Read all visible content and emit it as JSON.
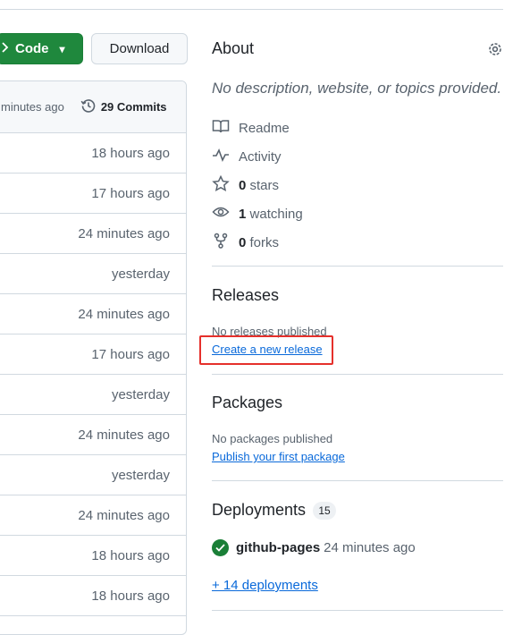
{
  "toolbar": {
    "code_label": "Code",
    "download_label": "Download"
  },
  "file_list": {
    "header_time": "minutes ago",
    "commits_label": "29 Commits",
    "rows": [
      "18 hours ago",
      "17 hours ago",
      "24 minutes ago",
      "yesterday",
      "24 minutes ago",
      "17 hours ago",
      "yesterday",
      "24 minutes ago",
      "yesterday",
      "24 minutes ago",
      "18 hours ago",
      "18 hours ago"
    ]
  },
  "about": {
    "title": "About",
    "description": "No description, website, or topics provided.",
    "readme": "Readme",
    "activity": "Activity",
    "stars_count": "0",
    "stars_label": "stars",
    "watching_count": "1",
    "watching_label": "watching",
    "forks_count": "0",
    "forks_label": "forks"
  },
  "releases": {
    "title": "Releases",
    "empty_text": "No releases published",
    "create_link": "Create a new release"
  },
  "packages": {
    "title": "Packages",
    "empty_text": "No packages published",
    "publish_link": "Publish your first package"
  },
  "deployments": {
    "title": "Deployments",
    "count": "15",
    "item_name": "github-pages",
    "item_time": "24 minutes ago",
    "more_link": "+ 14 deployments"
  },
  "colors": {
    "primary_button": "#1f883d",
    "link": "#0969da",
    "highlight_box": "#e5302b",
    "success": "#1a7f37"
  },
  "icons": [
    "code-icon",
    "history-icon",
    "gear-icon",
    "book-icon",
    "pulse-icon",
    "star-icon",
    "eye-icon",
    "fork-icon",
    "check-circle-icon"
  ]
}
